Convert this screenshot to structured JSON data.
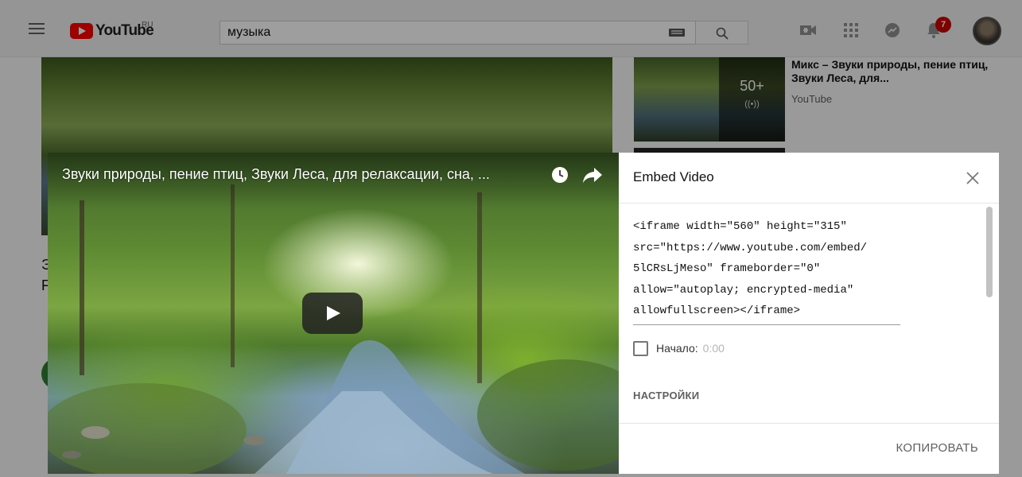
{
  "header": {
    "logo_text": "YouTube",
    "region": "RU",
    "search_value": "музыка",
    "notification_count": "7"
  },
  "background": {
    "main_title_partial": "Э",
    "main_title_partial_2": "F",
    "sidebar_video": {
      "title": "Микс – Звуки природы, пение птиц, Звуки Леса, для...",
      "channel": "YouTube",
      "count": "50+",
      "live_symbol": "((•))"
    }
  },
  "dialog": {
    "video_title": "Звуки природы, пение птиц, Звуки Леса, для релаксации, сна, ...",
    "embed_title": "Embed Video",
    "embed_code_lines": [
      "<iframe width=\"560\" height=\"315\"",
      "src=\"https://www.youtube.com/embed/",
      "5lCRsLjMeso\" frameborder=\"0\"",
      "allow=\"autoplay; encrypted-media\"",
      "allowfullscreen></iframe>"
    ],
    "start_label": "Начало:",
    "start_time": "0:00",
    "settings_label": "НАСТРОЙКИ",
    "copy_label": "КОПИРОВАТЬ"
  },
  "colors": {
    "brand_red": "#ff0000",
    "badge_red": "#cc0000"
  }
}
